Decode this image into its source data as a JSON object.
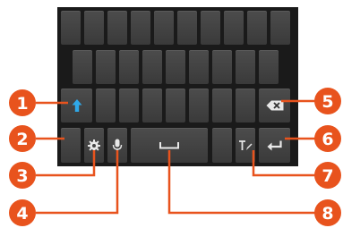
{
  "keyboard": {
    "rows": [
      {
        "id": "row-1",
        "key_count": 10
      },
      {
        "id": "row-2",
        "key_count": 9
      },
      {
        "id": "row-3",
        "key_count": 7
      }
    ],
    "special_keys": [
      {
        "id": "shift",
        "icon": "shift-up-arrow-icon",
        "color": "#2fa8e8"
      },
      {
        "id": "backspace",
        "icon": "backspace-icon"
      },
      {
        "id": "blank",
        "icon": ""
      },
      {
        "id": "settings",
        "icon": "gear-icon"
      },
      {
        "id": "voice-input",
        "icon": "microphone-icon"
      },
      {
        "id": "space",
        "icon": "space-bar-icon"
      },
      {
        "id": "handwriting",
        "icon": "text-pen-icon"
      },
      {
        "id": "enter",
        "icon": "enter-return-icon"
      }
    ]
  },
  "callouts": {
    "color": "#e8531d",
    "labels": [
      "1",
      "2",
      "3",
      "4",
      "5",
      "6",
      "7",
      "8"
    ]
  }
}
